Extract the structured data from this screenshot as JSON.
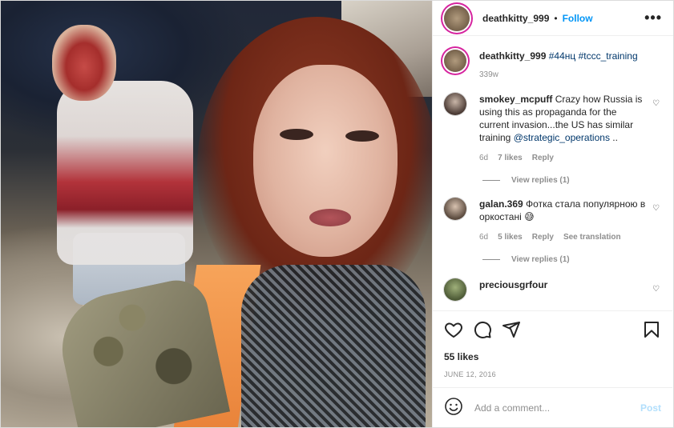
{
  "post": {
    "username": "deathkitty_999",
    "follow_label": "Follow",
    "separator": "•",
    "more_label": "•••"
  },
  "caption": {
    "username": "deathkitty_999",
    "text": "#44нц #tccc_training",
    "age": "339w"
  },
  "comments": [
    {
      "username": "smokey_mcpuff",
      "text": "Crazy how Russia is using this as propaganda for the current invasion...the US has similar training",
      "mention": "@strategic_operations",
      "suffix": " ..",
      "age": "6d",
      "likes": "7 likes",
      "reply": "Reply",
      "view_replies": "View replies (1)"
    },
    {
      "username": "galan.369",
      "text": "Фотка стала популярною в оркостані",
      "emoji": "😅",
      "age": "6d",
      "likes": "5 likes",
      "reply": "Reply",
      "see_translation": "See translation",
      "view_replies": "View replies (1)"
    },
    {
      "username": "preciousgrfour"
    }
  ],
  "footer": {
    "likes": "55 likes",
    "date": "JUNE 12, 2016",
    "comment_placeholder": "Add a comment...",
    "post_label": "Post"
  },
  "icons": {
    "like": "heart-icon",
    "comment": "comment-icon",
    "share": "share-icon",
    "save": "bookmark-icon",
    "emoji": "emoji-icon"
  }
}
